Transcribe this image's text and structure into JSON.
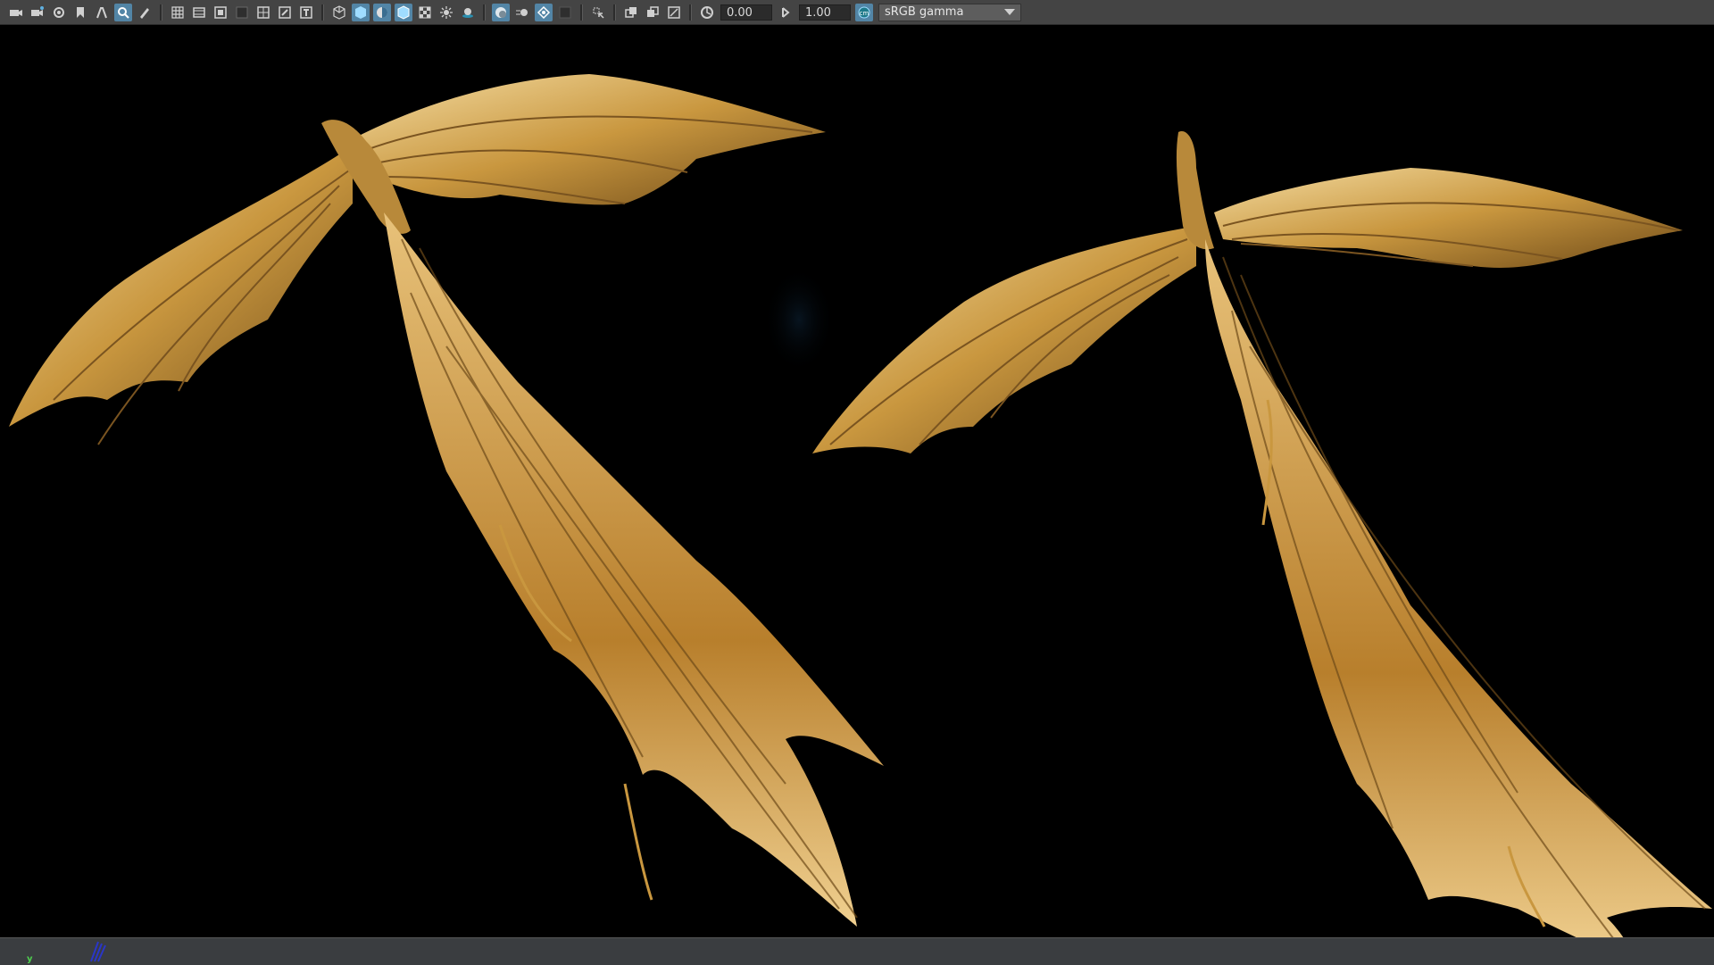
{
  "toolbar": {
    "buttons": [
      {
        "name": "camera-icon",
        "active": false
      },
      {
        "name": "camera-attributes-icon",
        "active": false
      },
      {
        "name": "camera-snapshot-icon",
        "active": false
      },
      {
        "name": "bookmark-icon",
        "active": false
      },
      {
        "name": "image-plane-icon",
        "active": false
      },
      {
        "name": "2d-pan-zoom-icon",
        "active": true
      },
      {
        "name": "grease-pencil-icon",
        "active": false
      },
      {
        "sep": true
      },
      {
        "name": "grid-icon",
        "active": false
      },
      {
        "name": "film-gate-icon",
        "active": false
      },
      {
        "name": "resolution-gate-icon",
        "active": false
      },
      {
        "name": "gate-mask-icon",
        "active": false
      },
      {
        "name": "field-chart-icon",
        "active": false
      },
      {
        "name": "safe-action-icon",
        "active": false
      },
      {
        "name": "safe-title-icon",
        "active": false
      },
      {
        "sep": true
      },
      {
        "name": "wireframe-icon",
        "active": false
      },
      {
        "name": "smooth-shade-icon",
        "active": true
      },
      {
        "name": "default-material-icon",
        "active": true
      },
      {
        "name": "wireframe-on-shaded-icon",
        "active": true
      },
      {
        "name": "textured-icon",
        "active": false
      },
      {
        "name": "use-all-lights-icon",
        "active": false
      },
      {
        "name": "shadows-icon",
        "active": false
      },
      {
        "sep": true
      },
      {
        "name": "screen-space-ao-icon",
        "active": true
      },
      {
        "name": "motion-blur-icon",
        "active": false
      },
      {
        "name": "anti-aliasing-icon",
        "active": true
      },
      {
        "name": "depth-of-field-icon",
        "active": false
      },
      {
        "sep": true
      },
      {
        "name": "isolate-select-icon",
        "active": false
      },
      {
        "sep": true
      },
      {
        "name": "xray-icon",
        "active": false
      },
      {
        "name": "xray-joints-icon",
        "active": false
      },
      {
        "name": "xray-active-components-icon",
        "active": false
      },
      {
        "sep": true
      },
      {
        "name": "exposure-reset-icon",
        "active": false
      }
    ],
    "exposure_value": "0.00",
    "gamma_icon": "gamma-icon",
    "gamma_value": "1.00",
    "colormanage_icon": "color-management-icon",
    "colorspace_label": "sRGB gamma"
  },
  "viewport": {
    "background": "#000000",
    "gold_light": "#f2d59a",
    "gold_mid": "#c9973f",
    "gold_dark": "#6e4a18"
  },
  "statusbar": {
    "axis_label": "y"
  }
}
